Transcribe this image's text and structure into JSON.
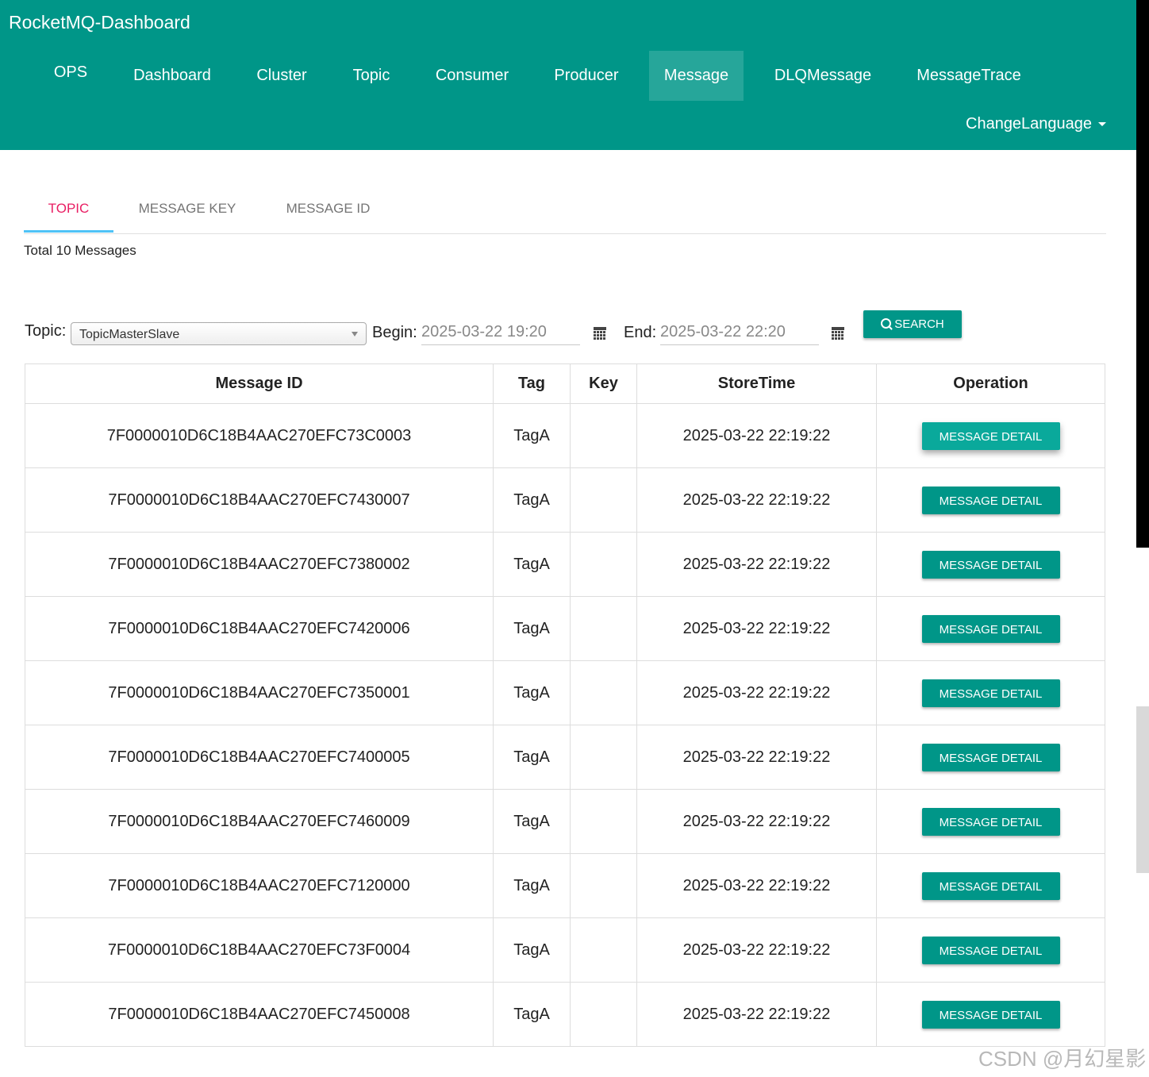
{
  "app": {
    "title": "RocketMQ-Dashboard"
  },
  "nav": {
    "items": [
      {
        "label": "OPS"
      },
      {
        "label": "Dashboard"
      },
      {
        "label": "Cluster"
      },
      {
        "label": "Topic"
      },
      {
        "label": "Consumer"
      },
      {
        "label": "Producer"
      },
      {
        "label": "Message"
      },
      {
        "label": "DLQMessage"
      },
      {
        "label": "MessageTrace"
      }
    ],
    "active": "Message",
    "change_language": "ChangeLanguage"
  },
  "tabs": [
    {
      "label": "TOPIC"
    },
    {
      "label": "MESSAGE KEY"
    },
    {
      "label": "MESSAGE ID"
    }
  ],
  "active_tab": "TOPIC",
  "summary": {
    "total_text": "Total 10 Messages"
  },
  "filters": {
    "topic_label": "Topic:",
    "topic_value": "TopicMasterSlave",
    "begin_label": "Begin:",
    "begin_value": "2025-03-22 19:20",
    "end_label": "End:",
    "end_value": "2025-03-22 22:20",
    "search_label": "SEARCH"
  },
  "table": {
    "columns": [
      "Message ID",
      "Tag",
      "Key",
      "StoreTime",
      "Operation"
    ],
    "button_label": "MESSAGE DETAIL",
    "rows": [
      {
        "id": "7F0000010D6C18B4AAC270EFC73C0003",
        "tag": "TagA",
        "key": "",
        "time": "2025-03-22 22:19:22"
      },
      {
        "id": "7F0000010D6C18B4AAC270EFC7430007",
        "tag": "TagA",
        "key": "",
        "time": "2025-03-22 22:19:22"
      },
      {
        "id": "7F0000010D6C18B4AAC270EFC7380002",
        "tag": "TagA",
        "key": "",
        "time": "2025-03-22 22:19:22"
      },
      {
        "id": "7F0000010D6C18B4AAC270EFC7420006",
        "tag": "TagA",
        "key": "",
        "time": "2025-03-22 22:19:22"
      },
      {
        "id": "7F0000010D6C18B4AAC270EFC7350001",
        "tag": "TagA",
        "key": "",
        "time": "2025-03-22 22:19:22"
      },
      {
        "id": "7F0000010D6C18B4AAC270EFC7400005",
        "tag": "TagA",
        "key": "",
        "time": "2025-03-22 22:19:22"
      },
      {
        "id": "7F0000010D6C18B4AAC270EFC7460009",
        "tag": "TagA",
        "key": "",
        "time": "2025-03-22 22:19:22"
      },
      {
        "id": "7F0000010D6C18B4AAC270EFC7120000",
        "tag": "TagA",
        "key": "",
        "time": "2025-03-22 22:19:22"
      },
      {
        "id": "7F0000010D6C18B4AAC270EFC73F0004",
        "tag": "TagA",
        "key": "",
        "time": "2025-03-22 22:19:22"
      },
      {
        "id": "7F0000010D6C18B4AAC270EFC7450008",
        "tag": "TagA",
        "key": "",
        "time": "2025-03-22 22:19:22"
      }
    ]
  },
  "watermark": "CSDN @月幻星影",
  "colors": {
    "primary": "#009688",
    "active_nav": "#26a69a",
    "active_tab": "#e91e63",
    "tab_ink": "#4fc3f7"
  },
  "icons": {
    "calendar": "calendar-icon",
    "search": "search-icon",
    "caret": "caret-down-icon"
  }
}
